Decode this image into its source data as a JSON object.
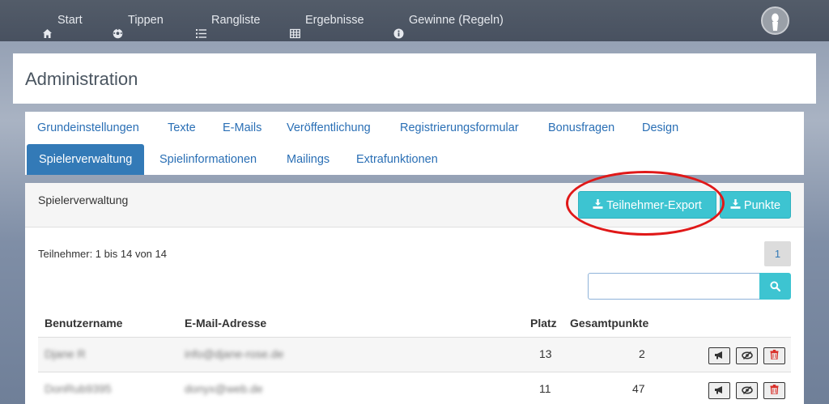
{
  "nav": {
    "items": [
      {
        "label": "Start",
        "icon": "home-icon"
      },
      {
        "label": "Tippen",
        "icon": "soccer-ball-icon"
      },
      {
        "label": "Rangliste",
        "icon": "list-icon"
      },
      {
        "label": "Ergebnisse",
        "icon": "table-icon"
      },
      {
        "label": "Gewinne (Regeln)",
        "icon": "info-icon"
      }
    ],
    "avatar_icon": "user-avatar-icon"
  },
  "header": {
    "title": "Administration"
  },
  "tabs": {
    "row1": [
      "Grundeinstellungen",
      "Texte",
      "E-Mails",
      "Veröffentlichung",
      "Registrierungsformular",
      "Bonusfragen",
      "Design"
    ],
    "row2": [
      "Spielerverwaltung",
      "Spielinformationen",
      "Mailings",
      "Extrafunktionen"
    ],
    "active": "Spielerverwaltung"
  },
  "content": {
    "section_title": "Spielerverwaltung",
    "export_button": "Teilnehmer-Export",
    "points_button": "Punkte",
    "count_text": "Teilnehmer: 1 bis 14 von 14",
    "page": "1",
    "search": {
      "value": "",
      "placeholder": ""
    }
  },
  "table": {
    "headers": {
      "username": "Benutzername",
      "email": "E-Mail-Adresse",
      "rank": "Platz",
      "points": "Gesamtpunkte"
    },
    "rows": [
      {
        "username": "Djane R",
        "email": "info@djane-rose.de",
        "rank": "13",
        "points": "2"
      },
      {
        "username": "DonRub9395",
        "email": "donyx@web.de",
        "rank": "11",
        "points": "47"
      }
    ]
  },
  "colors": {
    "nav_bg": "#4b5563",
    "accent_teal": "#3dc4d1",
    "active_tab": "#337ab7",
    "link": "#2a6fb5",
    "highlight": "#e01818"
  }
}
